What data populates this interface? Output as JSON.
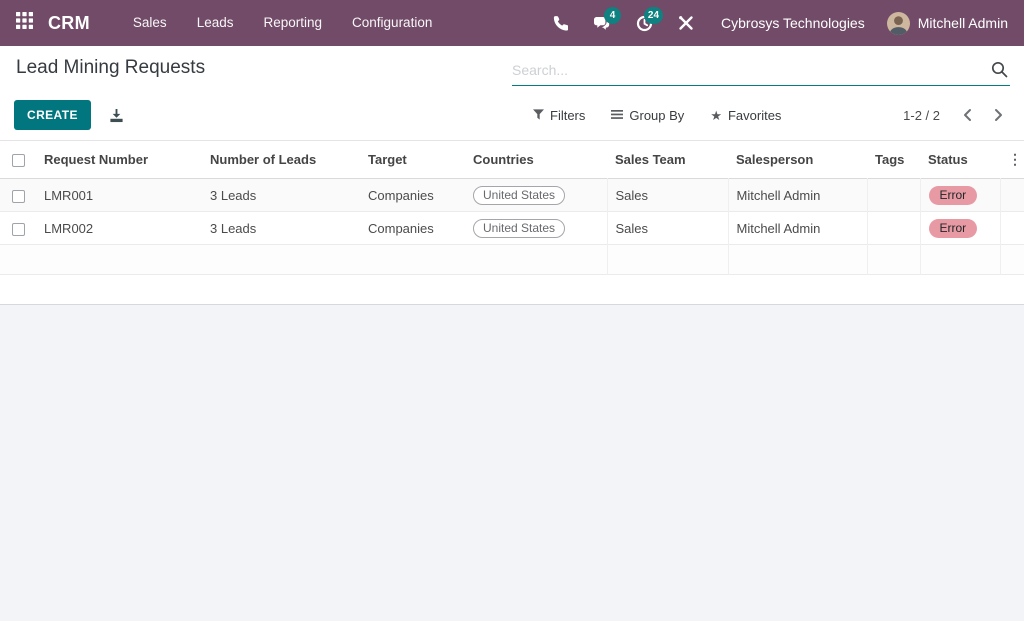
{
  "navbar": {
    "app_name": "CRM",
    "menu": [
      "Sales",
      "Leads",
      "Reporting",
      "Configuration"
    ],
    "systray": {
      "messages_badge": "4",
      "activities_badge": "24",
      "company": "Cybrosys Technologies",
      "user": "Mitchell Admin"
    }
  },
  "control_panel": {
    "title": "Lead Mining Requests",
    "search_placeholder": "Search...",
    "create_label": "CREATE",
    "filters_label": "Filters",
    "group_by_label": "Group By",
    "favorites_label": "Favorites",
    "pager": "1-2 / 2"
  },
  "table": {
    "headers": [
      "Request Number",
      "Number of Leads",
      "Target",
      "Countries",
      "Sales Team",
      "Salesperson",
      "Tags",
      "Status"
    ],
    "rows": [
      {
        "request_number": "LMR001",
        "number_of_leads": "3 Leads",
        "target": "Companies",
        "countries": "United States",
        "sales_team": "Sales",
        "salesperson": "Mitchell Admin",
        "tags": "",
        "status": "Error"
      },
      {
        "request_number": "LMR002",
        "number_of_leads": "3 Leads",
        "target": "Companies",
        "countries": "United States",
        "sales_team": "Sales",
        "salesperson": "Mitchell Admin",
        "tags": "",
        "status": "Error"
      }
    ]
  },
  "colors": {
    "navbar_bg": "#714B67",
    "accent_teal": "#017E84",
    "badge_teal": "#0E8180",
    "error_badge_bg": "#E79AA3"
  }
}
